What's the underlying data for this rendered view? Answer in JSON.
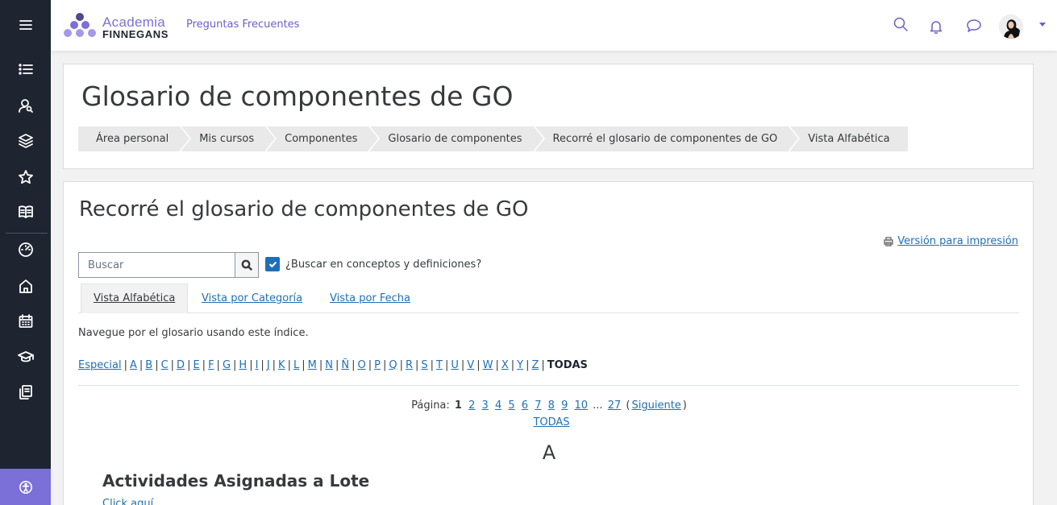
{
  "brand": {
    "line1": "Academia",
    "line2": "FINNEGANS"
  },
  "header": {
    "faq_link": "Preguntas Frecuentes"
  },
  "page": {
    "title": "Glosario de componentes de GO",
    "breadcrumbs": [
      "Área personal",
      "Mis cursos",
      "Componentes",
      "Glosario de componentes",
      "Recorré el glosario de componentes de GO",
      "Vista Alfabética"
    ]
  },
  "glossary": {
    "title": "Recorré el glosario de componentes de GO",
    "print_link": "Versión para impresión",
    "search": {
      "placeholder": "Buscar",
      "checkbox_label": "¿Buscar en conceptos y definiciones?",
      "checked": true
    },
    "tabs": [
      "Vista Alfabética",
      "Vista por Categoría",
      "Vista por Fecha"
    ],
    "intro": "Navegue por el glosario usando este índice.",
    "index_letters": [
      "Especial",
      "A",
      "B",
      "C",
      "D",
      "E",
      "F",
      "G",
      "H",
      "I",
      "J",
      "K",
      "L",
      "M",
      "N",
      "Ñ",
      "O",
      "P",
      "Q",
      "R",
      "S",
      "T",
      "U",
      "V",
      "W",
      "X",
      "Y",
      "Z"
    ],
    "index_current": "TODAS",
    "pagination": {
      "label": "Página:",
      "current": "1",
      "pages": [
        "2",
        "3",
        "4",
        "5",
        "6",
        "7",
        "8",
        "9",
        "10"
      ],
      "ellipsis": "...",
      "last": "27",
      "next": "Siguiente",
      "all": "TODAS"
    },
    "section_letter": "A",
    "entry": {
      "title": "Actividades Asignadas a Lote",
      "link": "Click aquí"
    }
  },
  "colors": {
    "rail": "#1e2430",
    "accent": "#7b70d8",
    "link": "#1f6fb5"
  },
  "icons": [
    "menu-icon",
    "list-icon",
    "user-search-icon",
    "layers-icon",
    "star-icon",
    "book-icon",
    "dashboard-icon",
    "home-icon",
    "calendar-icon",
    "graduation-cap-icon",
    "files-icon",
    "accessibility-icon",
    "search-icon",
    "bell-icon",
    "chat-icon",
    "printer-icon",
    "check-icon"
  ]
}
